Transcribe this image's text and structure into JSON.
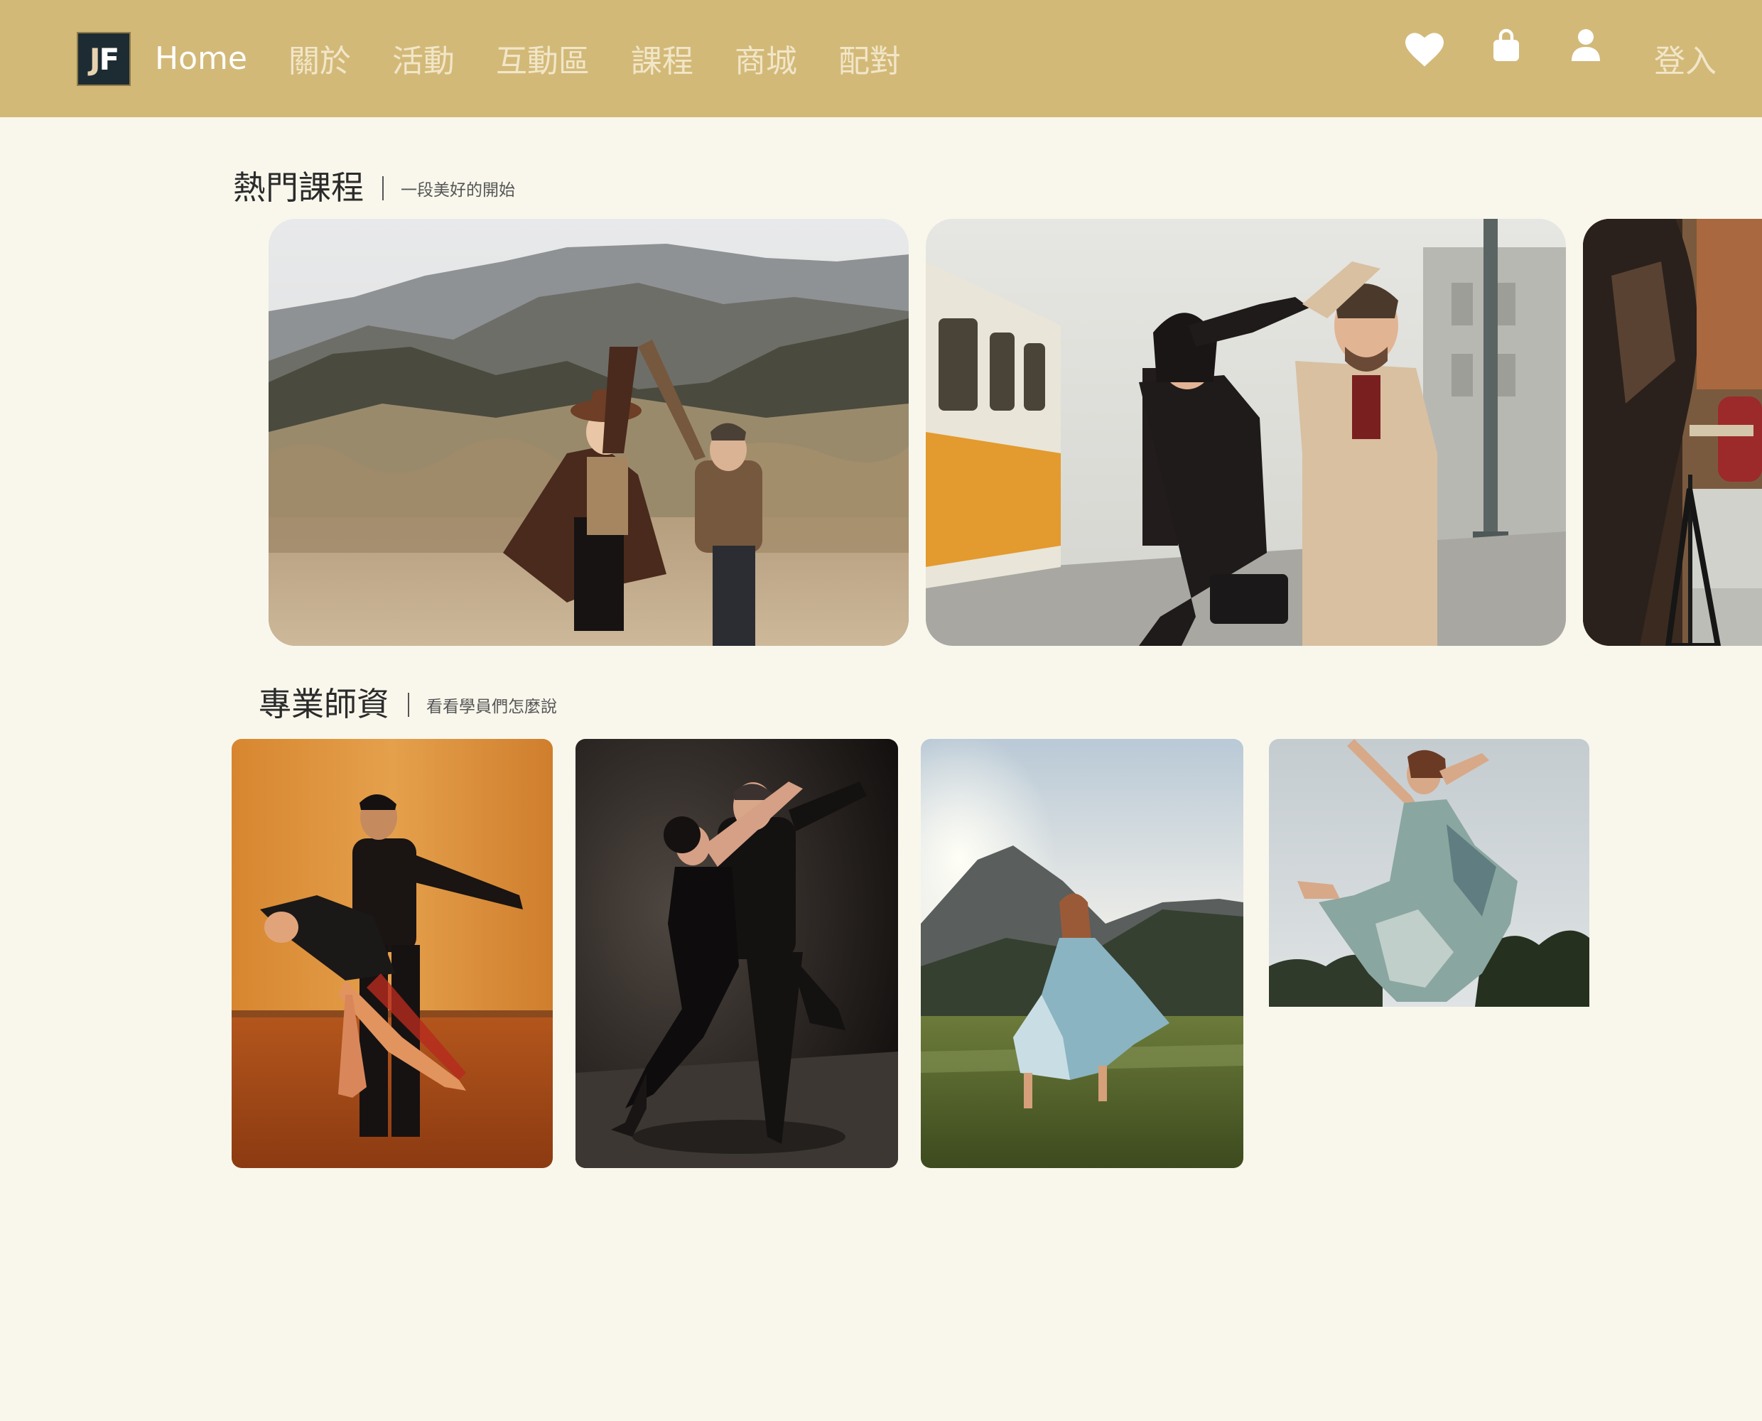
{
  "nav": {
    "logo_text": "JF",
    "links": [
      {
        "label": "Home"
      },
      {
        "label": "關於"
      },
      {
        "label": "活動"
      },
      {
        "label": "互動區"
      },
      {
        "label": "課程"
      },
      {
        "label": "商城"
      },
      {
        "label": "配對"
      }
    ],
    "icons": [
      "heart-icon",
      "shopping-bag-icon",
      "user-icon"
    ],
    "login_label": "登入"
  },
  "courses": {
    "title": "熱門課程",
    "subtitle": "一段美好的開始"
  },
  "teachers": {
    "title": "專業師資",
    "subtitle": "看看學員們怎麼說"
  },
  "colors": {
    "navbar_bg": "#d3b978",
    "page_bg": "#f9f7ec",
    "nav_text": "#f1e6c8",
    "nav_active": "#ffffff"
  }
}
